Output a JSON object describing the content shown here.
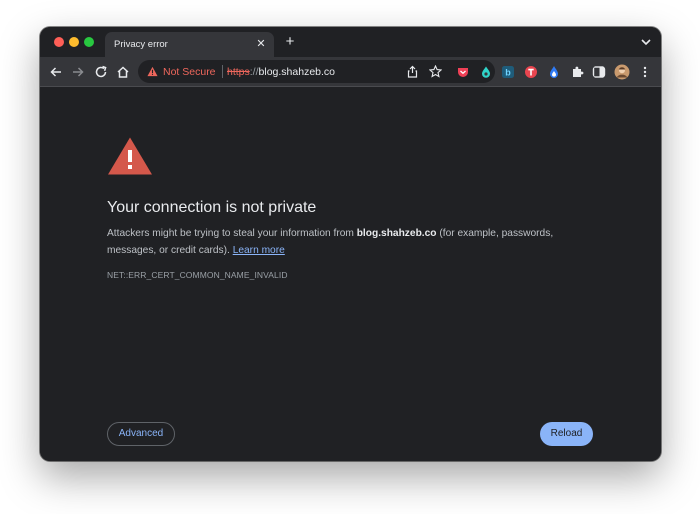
{
  "tab": {
    "title": "Privacy error",
    "close_icon": "close-icon",
    "new_tab_label": "+"
  },
  "toolbar": {
    "icons": [
      "back-arrow-icon",
      "forward-arrow-icon",
      "reload-icon",
      "home-icon"
    ]
  },
  "omnibox": {
    "security_label": "Not Secure",
    "url_scheme": "https",
    "url_separator": "://",
    "url_host": "blog.shahzeb.co"
  },
  "extensions": [
    "pocket-icon",
    "drop-icon",
    "b-extension-icon",
    "t-extension-icon",
    "flame-icon",
    "puzzle-icon",
    "sidepanel-icon",
    "avatar",
    "more-menu-icon"
  ],
  "page": {
    "heading": "Your connection is not private",
    "desc_before": "Attackers might be trying to steal your information from ",
    "desc_host": "blog.shahzeb.co",
    "desc_after": " (for example, passwords, messages, or credit cards). ",
    "learn_more": "Learn more",
    "error_code": "NET::ERR_CERT_COMMON_NAME_INVALID",
    "advanced_label": "Advanced",
    "reload_label": "Reload"
  },
  "colors": {
    "background": "#202124",
    "toolbar": "#35363a",
    "danger": "#ee675c",
    "warning_triangle": "#d4584b",
    "link": "#8ab4f8"
  }
}
